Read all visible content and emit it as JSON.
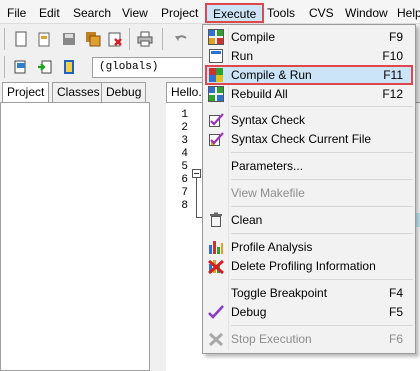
{
  "menubar": {
    "items": [
      "File",
      "Edit",
      "Search",
      "View",
      "Project",
      "Execute",
      "Tools",
      "CVS",
      "Window",
      "Help"
    ],
    "active": "Execute"
  },
  "toolbar2": {
    "combo_value": "(globals)"
  },
  "left_tabs": [
    "Project",
    "Classes",
    "Debug"
  ],
  "editor": {
    "tab_label": "Hello.c",
    "line_numbers": [
      "1",
      "2",
      "3",
      "4",
      "5",
      "6",
      "7",
      "8"
    ]
  },
  "execute_menu": {
    "items": [
      {
        "label": "Compile",
        "shortcut": "F9",
        "icon": "compile-icon",
        "enabled": true
      },
      {
        "label": "Run",
        "shortcut": "F10",
        "icon": "run-icon",
        "enabled": true
      },
      {
        "label": "Compile & Run",
        "shortcut": "F11",
        "icon": "compile-run-icon",
        "enabled": true,
        "highlighted": true
      },
      {
        "label": "Rebuild All",
        "shortcut": "F12",
        "icon": "rebuild-icon",
        "enabled": true
      },
      {
        "label": "Syntax Check",
        "shortcut": "",
        "icon": "syntax-check-icon",
        "enabled": true
      },
      {
        "label": "Syntax Check Current File",
        "shortcut": "",
        "icon": "syntax-check-file-icon",
        "enabled": true
      },
      {
        "label": "Parameters...",
        "shortcut": "",
        "icon": "",
        "enabled": true
      },
      {
        "label": "View Makefile",
        "shortcut": "",
        "icon": "",
        "enabled": false
      },
      {
        "label": "Clean",
        "shortcut": "",
        "icon": "clean-icon",
        "enabled": true
      },
      {
        "label": "Profile Analysis",
        "shortcut": "",
        "icon": "profile-icon",
        "enabled": true
      },
      {
        "label": "Delete Profiling Information",
        "shortcut": "",
        "icon": "delete-profile-icon",
        "enabled": true
      },
      {
        "label": "Toggle Breakpoint",
        "shortcut": "F4",
        "icon": "",
        "enabled": true
      },
      {
        "label": "Debug",
        "shortcut": "F5",
        "icon": "debug-check-icon",
        "enabled": true
      },
      {
        "label": "Stop Execution",
        "shortcut": "F6",
        "icon": "stop-icon",
        "enabled": false
      }
    ]
  },
  "colors": {
    "highlight_fill": "#cce4f7",
    "highlight_border": "#e0474c"
  }
}
